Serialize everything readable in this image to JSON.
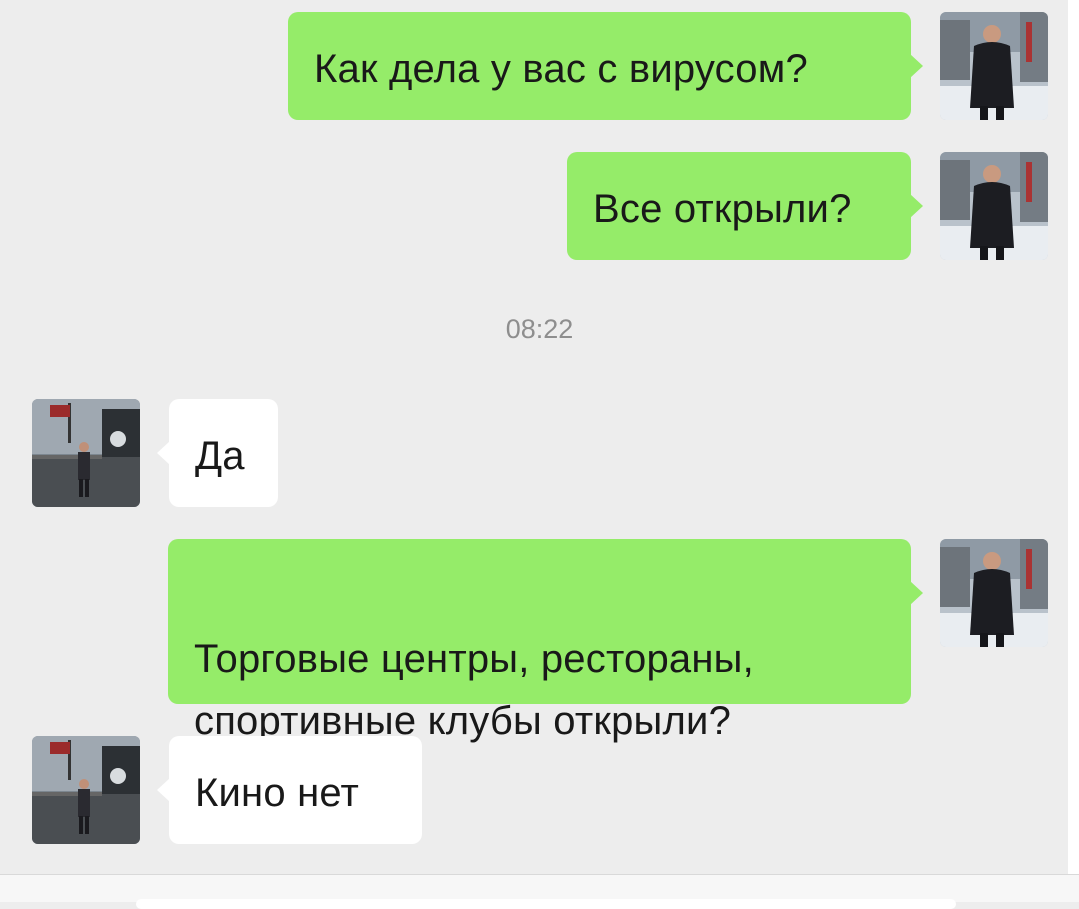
{
  "messages": [
    {
      "direction": "outgoing",
      "sender": "me",
      "text": "Как дела у вас с вирусом?"
    },
    {
      "direction": "outgoing",
      "sender": "me",
      "text": "Все открыли?"
    },
    {
      "direction": "incoming",
      "sender": "contact",
      "text": "Да"
    },
    {
      "direction": "outgoing",
      "sender": "me",
      "text": "Торговые центры, рестораны,\nспортивные клубы открыли?"
    },
    {
      "direction": "incoming",
      "sender": "contact",
      "text": "Кино нет"
    }
  ],
  "timestamp": "08:22",
  "colors": {
    "background": "#ededed",
    "outgoing_bubble": "#95ec69",
    "incoming_bubble": "#ffffff",
    "text": "#191919",
    "timestamp": "#8e8e8e"
  }
}
